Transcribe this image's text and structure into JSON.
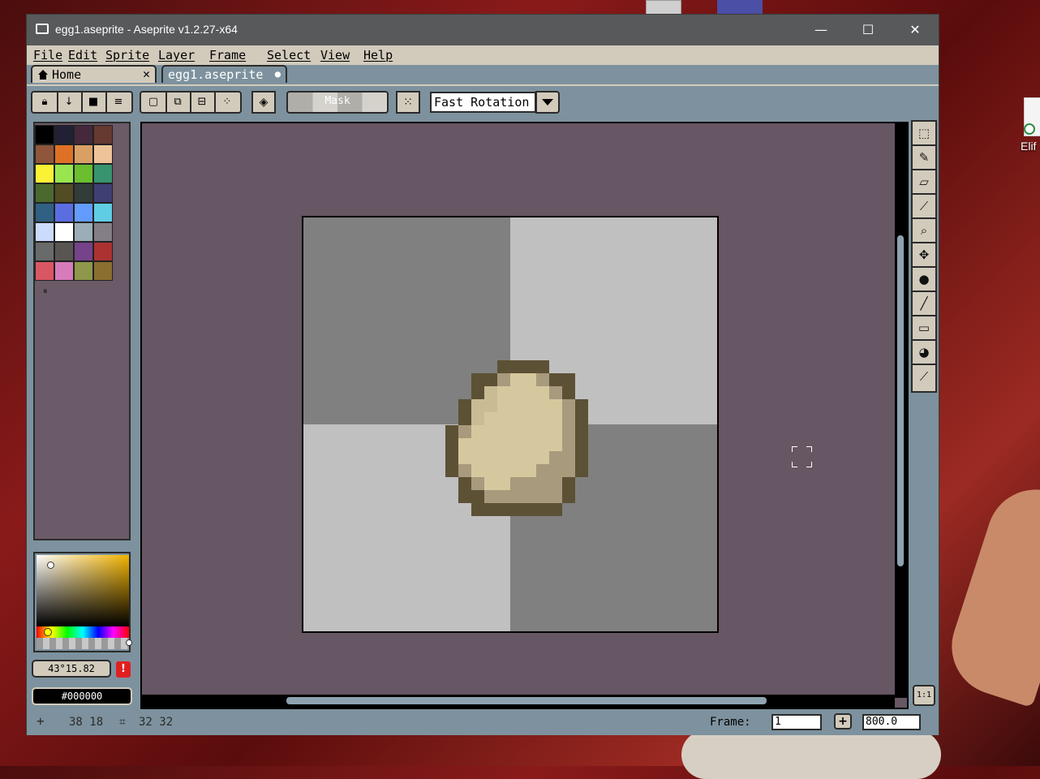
{
  "window": {
    "title": "egg1.aseprite - Aseprite v1.2.27-x64",
    "minimize": "—",
    "maximize": "☐",
    "close": "✕"
  },
  "menu": [
    "File",
    "Edit",
    "Sprite",
    "Layer",
    "Frame",
    "Select",
    "View",
    "Help"
  ],
  "tabs": {
    "home": {
      "label": "Home",
      "close": "✕"
    },
    "file": {
      "label": "egg1.aseprite",
      "modified": "●"
    }
  },
  "toolbar": {
    "mask_label": "Mask",
    "rotation_algorithm": "Fast Rotation"
  },
  "palette": {
    "colors": [
      "#000000",
      "#222034",
      "#45283c",
      "#663931",
      "#8f563b",
      "#df7126",
      "#d9a066",
      "#eec39a",
      "#fbf236",
      "#99e550",
      "#6abe30",
      "#37946e",
      "#4b692f",
      "#524b24",
      "#323c39",
      "#3f3f74",
      "#306082",
      "#5b6ee1",
      "#639bff",
      "#5fcde4",
      "#cbdbfc",
      "#ffffff",
      "#9badb7",
      "#847e87",
      "#696a6a",
      "#595652",
      "#76428a",
      "#ac3232",
      "#d95763",
      "#d77bba",
      "#8f974a",
      "#8a6f30"
    ]
  },
  "color_bar": {
    "tint_value": "43°15.82",
    "warning": "!",
    "hex_value": "#000000",
    "brand_color": "#d2cbbc"
  },
  "canvas": {
    "checker_dark": "#808080",
    "checker_light": "#c0c0c0",
    "background": "#675663"
  },
  "tools": [
    "rectangular-marquee",
    "pencil",
    "eraser",
    "eyedropper",
    "zoom",
    "move",
    "paint-bucket",
    "line",
    "rectangle",
    "contour",
    "blur"
  ],
  "status": {
    "cursor_pos": "38 18",
    "sprite_size": "32 32",
    "frame_label": "Frame:",
    "frame_value": "1",
    "add_frame": "+",
    "zoom": "800.0"
  },
  "desktop": {
    "icon_label": "Elif"
  }
}
